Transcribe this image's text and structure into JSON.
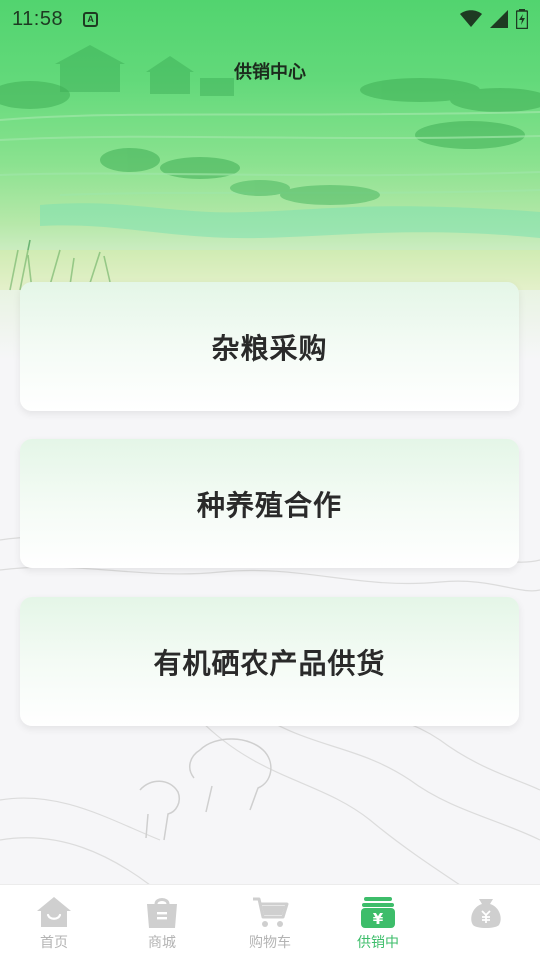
{
  "status_bar": {
    "time": "11:58",
    "notification_icon": "a-notification-icon",
    "icons": [
      "wifi-icon",
      "signal-icon",
      "battery-charging-icon"
    ]
  },
  "header": {
    "title": "供销中心"
  },
  "cards": [
    {
      "label": "杂粮采购"
    },
    {
      "label": "种养殖合作"
    },
    {
      "label": "有机硒农产品供货"
    }
  ],
  "bottom_nav": {
    "items": [
      {
        "label": "首页",
        "icon": "home-icon",
        "active": false
      },
      {
        "label": "商城",
        "icon": "shopping-bag-icon",
        "active": false
      },
      {
        "label": "购物车",
        "icon": "cart-icon",
        "active": false
      },
      {
        "label": "供销中",
        "icon": "supply-center-icon",
        "active": true
      },
      {
        "label": "",
        "icon": "money-bag-icon",
        "active": false
      }
    ]
  },
  "colors": {
    "primary_green": "#3dbd6a",
    "hero_green": "#52d46f",
    "inactive_icon": "#c8c8c8"
  }
}
